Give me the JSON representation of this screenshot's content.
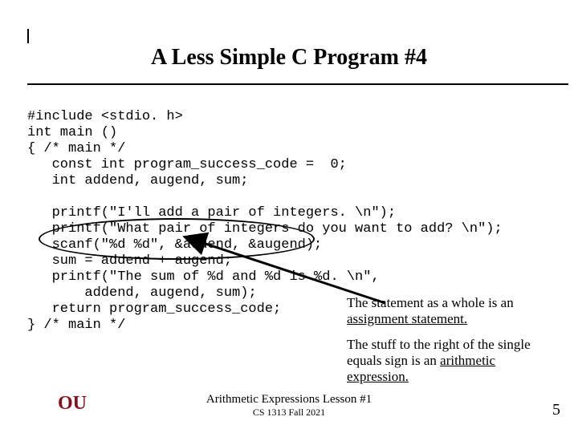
{
  "title": "A Less Simple C Program #4",
  "code": {
    "l1": "#include <stdio. h>",
    "l2": "int main ()",
    "l3": "{ /* main */",
    "l4": "const int program_success_code =  0;",
    "l5": "int addend, augend, sum;",
    "l6": "printf(\"I'll add a pair of integers. \\n\");",
    "l7": "printf(\"What pair of integers do you want to add? \\n\");",
    "l8": "scanf(\"%d %d\", &addend, &augend);",
    "l9": "sum = addend + augend;",
    "l10": "printf(\"The sum of %d and %d is %d. \\n\",",
    "l11": "addend, augend, sum);",
    "l12": "return program_success_code;",
    "l13": "} /* main */"
  },
  "note1": {
    "a": "The statement as a whole is an ",
    "b": "assignment statement."
  },
  "note2": {
    "a": "The stuff to the right of the single equals sign is an ",
    "b": "arithmetic expression."
  },
  "footer": {
    "line1": "Arithmetic Expressions Lesson #1",
    "line2": "CS 1313 Fall 2021"
  },
  "slidenum": "5",
  "logo": {
    "text": "OU",
    "color": "#8a0f1a"
  }
}
